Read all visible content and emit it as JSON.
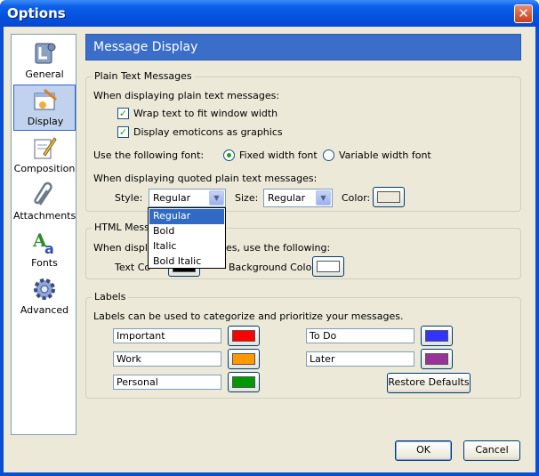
{
  "window": {
    "title": "Options",
    "close_glyph": "✕"
  },
  "sidebar": {
    "items": [
      {
        "label": "General",
        "icon": "general-icon"
      },
      {
        "label": "Display",
        "icon": "display-icon",
        "selected": true
      },
      {
        "label": "Composition",
        "icon": "composition-icon"
      },
      {
        "label": "Attachments",
        "icon": "attachments-icon"
      },
      {
        "label": "Fonts",
        "icon": "fonts-icon"
      },
      {
        "label": "Advanced",
        "icon": "advanced-icon"
      }
    ]
  },
  "panel": {
    "title": "Message Display"
  },
  "plain": {
    "legend": "Plain Text Messages",
    "intro": "When displaying plain text messages:",
    "wrap_label": "Wrap text to fit window width",
    "emoticons_label": "Display emoticons as graphics",
    "font_prompt": "Use the following font:",
    "fixed_label": "Fixed width font",
    "variable_label": "Variable width font",
    "quoted_intro": "When displaying quoted plain text messages:",
    "style_label": "Style:",
    "style_value": "Regular",
    "size_label": "Size:",
    "size_value": "Regular",
    "color_label": "Color:",
    "color_value": "#ece9d8"
  },
  "style_dropdown": {
    "options": [
      "Regular",
      "Bold",
      "Italic",
      "Bold Italic"
    ],
    "selected": "Regular"
  },
  "html": {
    "legend_visible": "HTML Messag",
    "intro_left": "When displ",
    "intro_right": "es, use the following:",
    "text_color_label": "Text Co",
    "text_color_value": "#000000",
    "bg_color_label": "Background Color:",
    "bg_color_value": "#ffffff"
  },
  "labels": {
    "legend": "Labels",
    "intro": "Labels can be used to categorize and prioritize your messages.",
    "items": [
      {
        "name": "Important",
        "color": "#ff0000"
      },
      {
        "name": "To Do",
        "color": "#3333ff"
      },
      {
        "name": "Work",
        "color": "#ff9900"
      },
      {
        "name": "Later",
        "color": "#993399"
      },
      {
        "name": "Personal",
        "color": "#009900"
      }
    ],
    "restore_label": "Restore Defaults"
  },
  "footer": {
    "ok_label": "OK",
    "cancel_label": "Cancel"
  }
}
